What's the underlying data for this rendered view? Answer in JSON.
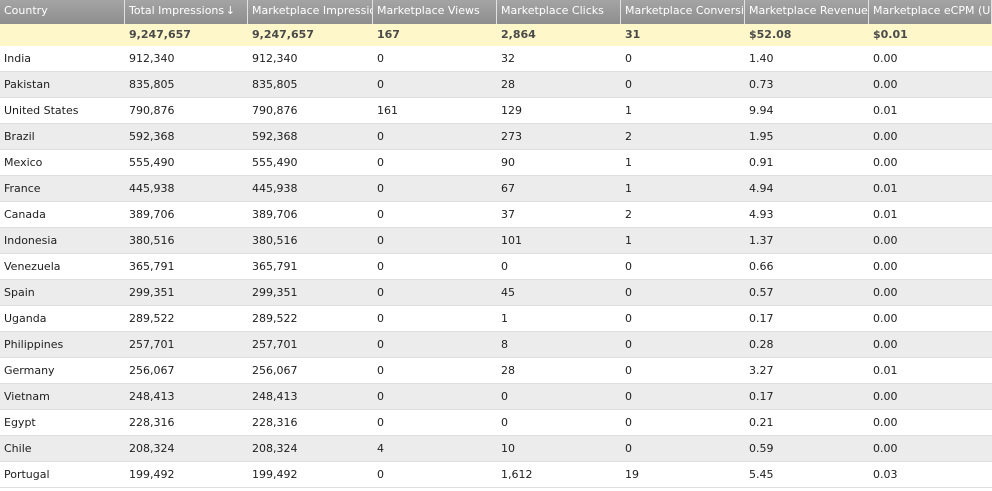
{
  "columns": [
    {
      "key": "country",
      "label": "Country"
    },
    {
      "key": "total_impressions",
      "label": "Total Impressions"
    },
    {
      "key": "marketplace_impressions",
      "label": "Marketplace Impressions"
    },
    {
      "key": "marketplace_views",
      "label": "Marketplace Views"
    },
    {
      "key": "marketplace_clicks",
      "label": "Marketplace Clicks"
    },
    {
      "key": "marketplace_conversions",
      "label": "Marketplace Conversions"
    },
    {
      "key": "marketplace_revenue",
      "label": "Marketplace Revenue (U"
    },
    {
      "key": "marketplace_ecpm",
      "label": "Marketplace eCPM (USD)"
    }
  ],
  "sort": {
    "column": "total_impressions",
    "direction": "descending",
    "icon": "sort-down-arrow-icon",
    "glyph": "↓"
  },
  "totals": [
    "",
    "9,247,657",
    "9,247,657",
    "167",
    "2,864",
    "31",
    "$52.08",
    "$0.01"
  ],
  "rows": [
    [
      "India",
      "912,340",
      "912,340",
      "0",
      "32",
      "0",
      "1.40",
      "0.00"
    ],
    [
      "Pakistan",
      "835,805",
      "835,805",
      "0",
      "28",
      "0",
      "0.73",
      "0.00"
    ],
    [
      "United States",
      "790,876",
      "790,876",
      "161",
      "129",
      "1",
      "9.94",
      "0.01"
    ],
    [
      "Brazil",
      "592,368",
      "592,368",
      "0",
      "273",
      "2",
      "1.95",
      "0.00"
    ],
    [
      "Mexico",
      "555,490",
      "555,490",
      "0",
      "90",
      "1",
      "0.91",
      "0.00"
    ],
    [
      "France",
      "445,938",
      "445,938",
      "0",
      "67",
      "1",
      "4.94",
      "0.01"
    ],
    [
      "Canada",
      "389,706",
      "389,706",
      "0",
      "37",
      "2",
      "4.93",
      "0.01"
    ],
    [
      "Indonesia",
      "380,516",
      "380,516",
      "0",
      "101",
      "1",
      "1.37",
      "0.00"
    ],
    [
      "Venezuela",
      "365,791",
      "365,791",
      "0",
      "0",
      "0",
      "0.66",
      "0.00"
    ],
    [
      "Spain",
      "299,351",
      "299,351",
      "0",
      "45",
      "0",
      "0.57",
      "0.00"
    ],
    [
      "Uganda",
      "289,522",
      "289,522",
      "0",
      "1",
      "0",
      "0.17",
      "0.00"
    ],
    [
      "Philippines",
      "257,701",
      "257,701",
      "0",
      "8",
      "0",
      "0.28",
      "0.00"
    ],
    [
      "Germany",
      "256,067",
      "256,067",
      "0",
      "28",
      "0",
      "3.27",
      "0.01"
    ],
    [
      "Vietnam",
      "248,413",
      "248,413",
      "0",
      "0",
      "0",
      "0.17",
      "0.00"
    ],
    [
      "Egypt",
      "228,316",
      "228,316",
      "0",
      "0",
      "0",
      "0.21",
      "0.00"
    ],
    [
      "Chile",
      "208,324",
      "208,324",
      "4",
      "10",
      "0",
      "0.59",
      "0.00"
    ],
    [
      "Portugal",
      "199,492",
      "199,492",
      "0",
      "1,612",
      "19",
      "5.45",
      "0.03"
    ]
  ],
  "colors": {
    "header_bg": "#999999",
    "header_text": "#ffffff",
    "totals_bg": "#fdf7c9",
    "row_alt_bg": "#ececec",
    "text": "#1e1e1e"
  }
}
